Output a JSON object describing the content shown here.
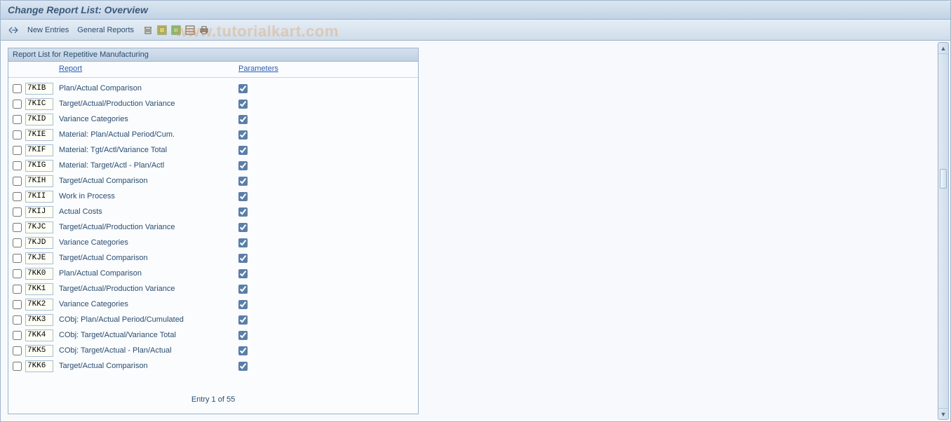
{
  "title": "Change Report List: Overview",
  "toolbar": {
    "new_entries": "New Entries",
    "general_reports": "General Reports"
  },
  "panel": {
    "header": "Report List for Repetitive Manufacturing",
    "col_report": "Report",
    "col_params": "Parameters"
  },
  "rows": [
    {
      "code": "7KIB",
      "report": "Plan/Actual Comparison",
      "param": true
    },
    {
      "code": "7KIC",
      "report": "Target/Actual/Production Variance",
      "param": true
    },
    {
      "code": "7KID",
      "report": "Variance Categories",
      "param": true
    },
    {
      "code": "7KIE",
      "report": "Material: Plan/Actual Period/Cum.",
      "param": true
    },
    {
      "code": "7KIF",
      "report": "Material: Tgt/Actl/Variance Total",
      "param": true
    },
    {
      "code": "7KIG",
      "report": "Material: Target/Actl - Plan/Actl",
      "param": true
    },
    {
      "code": "7KIH",
      "report": "Target/Actual Comparison",
      "param": true
    },
    {
      "code": "7KII",
      "report": "Work in Process",
      "param": true
    },
    {
      "code": "7KIJ",
      "report": "Actual Costs",
      "param": true
    },
    {
      "code": "7KJC",
      "report": "Target/Actual/Production Variance",
      "param": true
    },
    {
      "code": "7KJD",
      "report": "Variance Categories",
      "param": true
    },
    {
      "code": "7KJE",
      "report": "Target/Actual Comparison",
      "param": true
    },
    {
      "code": "7KK0",
      "report": "Plan/Actual Comparison",
      "param": true
    },
    {
      "code": "7KK1",
      "report": "Target/Actual/Production Variance",
      "param": true
    },
    {
      "code": "7KK2",
      "report": "Variance Categories",
      "param": true
    },
    {
      "code": "7KK3",
      "report": "CObj: Plan/Actual Period/Cumulated",
      "param": true
    },
    {
      "code": "7KK4",
      "report": "CObj: Target/Actual/Variance Total",
      "param": true
    },
    {
      "code": "7KK5",
      "report": "CObj: Target/Actual - Plan/Actual",
      "param": true
    },
    {
      "code": "7KK6",
      "report": "Target/Actual Comparison",
      "param": true
    }
  ],
  "footer": "Entry 1 of 55",
  "watermark": "www.tutorialkart.com"
}
